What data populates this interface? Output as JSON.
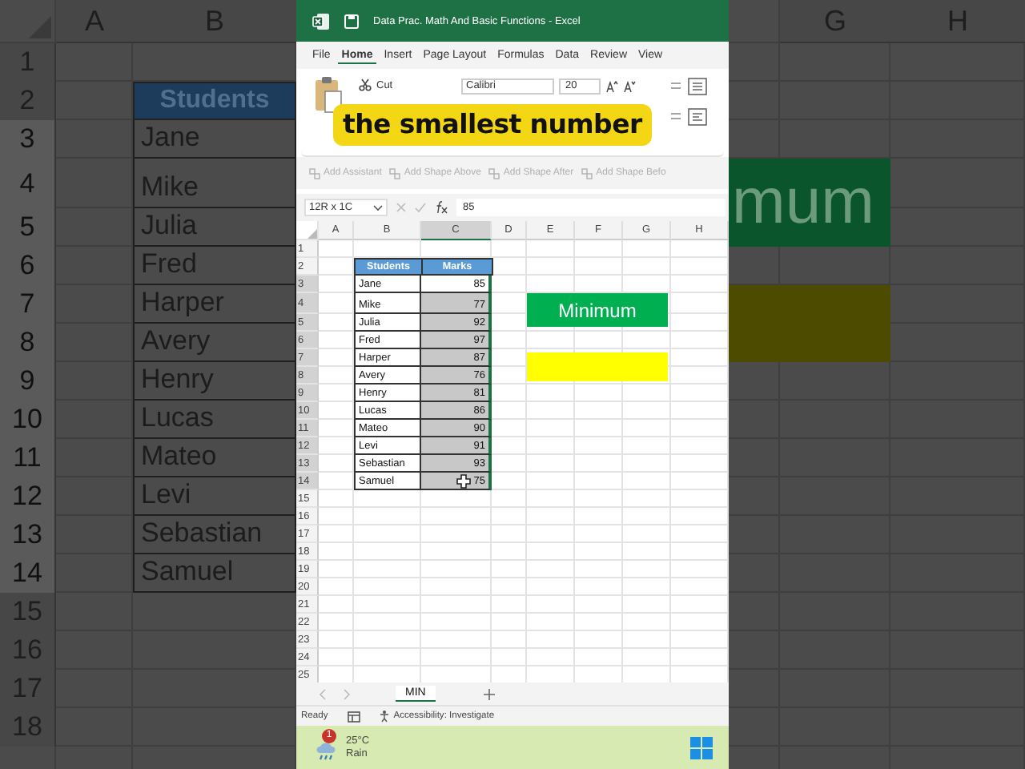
{
  "backdrop_left": {
    "column_headers": [
      "A",
      "B"
    ],
    "row_numbers": [
      {
        "label": "1",
        "selected": false
      },
      {
        "label": "2",
        "selected": false
      },
      {
        "label": "3",
        "selected": true
      },
      {
        "label": "4",
        "selected": true
      },
      {
        "label": "5",
        "selected": true
      },
      {
        "label": "6",
        "selected": true
      },
      {
        "label": "7",
        "selected": true
      },
      {
        "label": "8",
        "selected": true
      },
      {
        "label": "9",
        "selected": true
      },
      {
        "label": "10",
        "selected": true
      },
      {
        "label": "11",
        "selected": true
      },
      {
        "label": "12",
        "selected": true
      },
      {
        "label": "13",
        "selected": true
      },
      {
        "label": "14",
        "selected": true
      },
      {
        "label": "15",
        "selected": false
      },
      {
        "label": "16",
        "selected": false
      },
      {
        "label": "17",
        "selected": false
      },
      {
        "label": "18",
        "selected": false
      }
    ],
    "table_header": "Students",
    "names": [
      "Jane",
      "Mike",
      "Julia",
      "Fred",
      "Harper",
      "Avery",
      "Henry",
      "Lucas",
      "Mateo",
      "Levi",
      "Sebastian",
      "Samuel"
    ]
  },
  "window": {
    "title": "Data Prac. Math And Basic Functions  -  Excel"
  },
  "ribbon_tabs": [
    {
      "label": "File",
      "selected": false
    },
    {
      "label": "Home",
      "selected": true
    },
    {
      "label": "Insert",
      "selected": false
    },
    {
      "label": "Page Layout",
      "selected": false
    },
    {
      "label": "Formulas",
      "selected": false
    },
    {
      "label": "Data",
      "selected": false
    },
    {
      "label": "Review",
      "selected": false
    },
    {
      "label": "View",
      "selected": false
    }
  ],
  "ribbon": {
    "cut": "Cut",
    "font_name": "Calibri",
    "font_size": "20"
  },
  "caption": "the smallest number",
  "smartart_buttons": [
    {
      "label": "Add Assistant",
      "disabled": true
    },
    {
      "label": "Add Shape Above",
      "disabled": true
    },
    {
      "label": "Add Shape After",
      "disabled": true
    },
    {
      "label": "Add Shape Befo",
      "disabled": true
    }
  ],
  "formula_bar": {
    "name_box": "12R x 1C",
    "value": "85"
  },
  "sheet": {
    "column_headers": [
      {
        "label": "A",
        "selected": false
      },
      {
        "label": "B",
        "selected": false
      },
      {
        "label": "C",
        "selected": true
      },
      {
        "label": "D",
        "selected": false
      },
      {
        "label": "E",
        "selected": false
      },
      {
        "label": "F",
        "selected": false
      },
      {
        "label": "G",
        "selected": false
      },
      {
        "label": "H",
        "selected": false
      }
    ],
    "row_numbers": [
      {
        "label": "1",
        "selected": false
      },
      {
        "label": "2",
        "selected": false
      },
      {
        "label": "3",
        "selected": true
      },
      {
        "label": "4",
        "selected": true
      },
      {
        "label": "5",
        "selected": true
      },
      {
        "label": "6",
        "selected": true
      },
      {
        "label": "7",
        "selected": true
      },
      {
        "label": "8",
        "selected": true
      },
      {
        "label": "9",
        "selected": true
      },
      {
        "label": "10",
        "selected": true
      },
      {
        "label": "11",
        "selected": true
      },
      {
        "label": "12",
        "selected": true
      },
      {
        "label": "13",
        "selected": true
      },
      {
        "label": "14",
        "selected": true
      },
      {
        "label": "15",
        "selected": false
      },
      {
        "label": "16",
        "selected": false
      },
      {
        "label": "17",
        "selected": false
      },
      {
        "label": "18",
        "selected": false
      },
      {
        "label": "19",
        "selected": false
      },
      {
        "label": "20",
        "selected": false
      },
      {
        "label": "21",
        "selected": false
      },
      {
        "label": "22",
        "selected": false
      },
      {
        "label": "23",
        "selected": false
      },
      {
        "label": "24",
        "selected": false
      },
      {
        "label": "25",
        "selected": false
      }
    ],
    "table": {
      "columns": [
        "Students",
        "Marks"
      ],
      "rows": [
        {
          "student": "Jane",
          "mark": "85",
          "selected": true,
          "active": true
        },
        {
          "student": "Mike",
          "mark": "77",
          "selected": true,
          "active": false
        },
        {
          "student": "Julia",
          "mark": "92",
          "selected": true,
          "active": false
        },
        {
          "student": "Fred",
          "mark": "97",
          "selected": true,
          "active": false
        },
        {
          "student": "Harper",
          "mark": "87",
          "selected": true,
          "active": false
        },
        {
          "student": "Avery",
          "mark": "76",
          "selected": true,
          "active": false
        },
        {
          "student": "Henry",
          "mark": "81",
          "selected": true,
          "active": false
        },
        {
          "student": "Lucas",
          "mark": "86",
          "selected": true,
          "active": false
        },
        {
          "student": "Mateo",
          "mark": "90",
          "selected": true,
          "active": false
        },
        {
          "student": "Levi",
          "mark": "91",
          "selected": true,
          "active": false
        },
        {
          "student": "Sebastian",
          "mark": "93",
          "selected": true,
          "active": false
        },
        {
          "student": "Samuel",
          "mark": "75",
          "selected": true,
          "active": false
        }
      ]
    },
    "minimum_label": "Minimum"
  },
  "sheet_tabs": [
    {
      "label": "MIN",
      "selected": true
    }
  ],
  "status_bar": {
    "status": "Ready",
    "accessibility": "Accessibility: Investigate"
  },
  "taskbar": {
    "notification_count": "1",
    "temperature": "25°C",
    "condition": "Rain"
  },
  "backdrop_right": {
    "column_headers": [
      "G",
      "H"
    ],
    "minimum_fragment": "mum"
  }
}
